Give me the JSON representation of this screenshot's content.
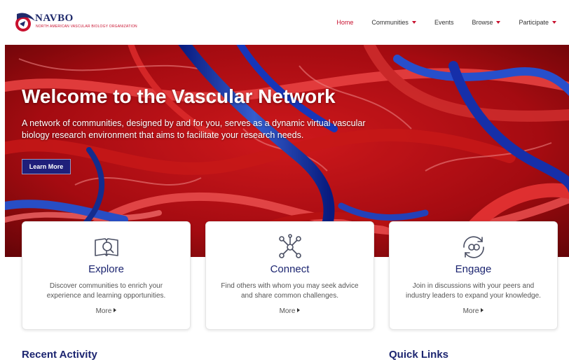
{
  "brand": {
    "name": "NAVBO",
    "tagline": "NORTH AMERICAN VASCULAR BIOLOGY ORGANIZATION",
    "primary": "#1c2570",
    "accent": "#c8102e"
  },
  "nav": {
    "items": [
      {
        "label": "Home",
        "active": true,
        "dropdown": false
      },
      {
        "label": "Communities",
        "active": false,
        "dropdown": true
      },
      {
        "label": "Events",
        "active": false,
        "dropdown": false
      },
      {
        "label": "Browse",
        "active": false,
        "dropdown": true
      },
      {
        "label": "Participate",
        "active": false,
        "dropdown": true
      }
    ]
  },
  "hero": {
    "title": "Welcome to the Vascular Network",
    "description": "A network of communities, designed by and for you, serves as a dynamic virtual vascular biology research environment that aims to facilitate your research needs.",
    "button_label": "Learn More"
  },
  "cards": [
    {
      "icon": "search-book-icon",
      "title": "Explore",
      "description": "Discover communities to enrich your experience and learning opportunities.",
      "more_label": "More"
    },
    {
      "icon": "network-nodes-icon",
      "title": "Connect",
      "description": "Find others with whom you may seek advice and share common challenges.",
      "more_label": "More"
    },
    {
      "icon": "engage-cycle-icon",
      "title": "Engage",
      "description": "Join in discussions with your peers and industry leaders to expand your knowledge.",
      "more_label": "More"
    }
  ],
  "sections": {
    "recent_activity": "Recent Activity",
    "quick_links": "Quick Links"
  }
}
